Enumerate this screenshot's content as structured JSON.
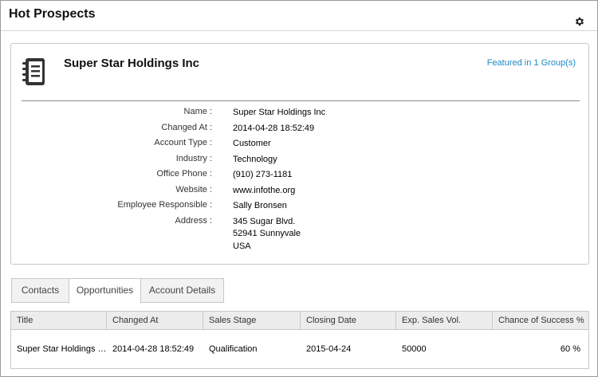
{
  "header": {
    "title": "Hot Prospects"
  },
  "account": {
    "name": "Super Star Holdings Inc",
    "featured_link": "Featured in 1 Group(s)",
    "fields": {
      "name_label": "Name :",
      "name_value": "Super Star Holdings Inc",
      "changed_label": "Changed At :",
      "changed_value": "2014-04-28 18:52:49",
      "type_label": "Account Type :",
      "type_value": "Customer",
      "industry_label": "Industry :",
      "industry_value": "Technology",
      "phone_label": "Office Phone :",
      "phone_value": "(910) 273-1181",
      "website_label": "Website :",
      "website_value": "www.infothe.org",
      "employee_label": "Employee Responsible :",
      "employee_value": "Sally Bronsen",
      "address_label": "Address :",
      "address_line1": "345 Sugar Blvd.",
      "address_line2": "52941 Sunnyvale",
      "address_line3": "USA"
    }
  },
  "tabs": [
    {
      "label": "Contacts"
    },
    {
      "label": "Opportunities"
    },
    {
      "label": "Account Details"
    }
  ],
  "active_tab": "Opportunities",
  "grid": {
    "columns": [
      "Title",
      "Changed At",
      "Sales Stage",
      "Closing Date",
      "Exp. Sales Vol.",
      "Chance of Success %"
    ],
    "rows": [
      {
        "title": "Super Star Holdings Inc",
        "changed_at": "2014-04-28 18:52:49",
        "sales_stage": "Qualification",
        "closing_date": "2015-04-24",
        "exp_sales_vol": "50000",
        "chance": "60 %"
      }
    ]
  },
  "icons": {
    "settings": "gear-icon",
    "account": "address-book-icon"
  },
  "colors": {
    "link": "#1e88c7",
    "border": "#c8c8c8",
    "header_bg": "#ececec"
  }
}
